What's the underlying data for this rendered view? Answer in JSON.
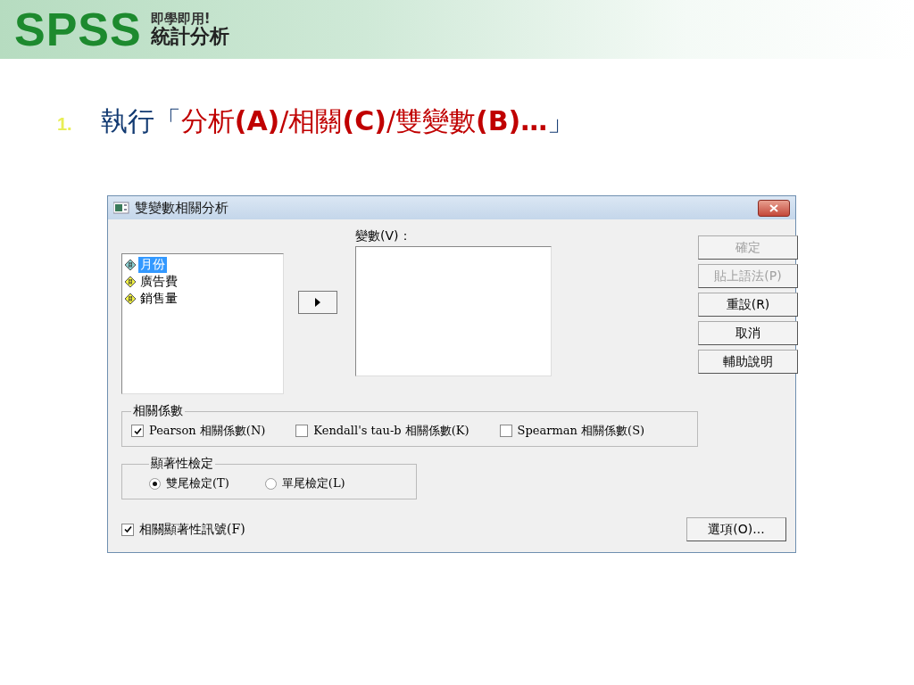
{
  "banner": {
    "logo": "SPSS",
    "tagline": "即學即用!",
    "subtitle": "統計分析"
  },
  "step": {
    "number": "1.",
    "prefix": "執行「",
    "path": "分析**(A)**/相關**(C)**/雙變數**(B)…**",
    "suffix": "」"
  },
  "dialog": {
    "title": "雙變數相關分析",
    "source_list": [
      {
        "label": "月份",
        "selected": true
      },
      {
        "label": "廣告費",
        "selected": false
      },
      {
        "label": "銷售量",
        "selected": false
      }
    ],
    "target_label": "變數(V)：",
    "buttons": [
      {
        "label": "確定",
        "disabled": true
      },
      {
        "label": "貼上語法(P)",
        "disabled": true
      },
      {
        "label": "重設(R)",
        "disabled": false
      },
      {
        "label": "取消",
        "disabled": false
      },
      {
        "label": "輔助說明",
        "disabled": false
      }
    ],
    "coefficients": {
      "title": "相關係數",
      "options": [
        {
          "label": "Pearson 相關係數(N)",
          "checked": true
        },
        {
          "label": "Kendall's tau-b 相關係數(K)",
          "checked": false
        },
        {
          "label": "Spearman 相關係數(S)",
          "checked": false
        }
      ]
    },
    "significance": {
      "title": "顯著性檢定",
      "options": [
        {
          "label": "雙尾檢定(T)",
          "selected": true
        },
        {
          "label": "單尾檢定(L)",
          "selected": false
        }
      ]
    },
    "flag": {
      "label": "相關顯著性訊號(F)",
      "checked": true
    },
    "options_button": "選項(O)..."
  }
}
